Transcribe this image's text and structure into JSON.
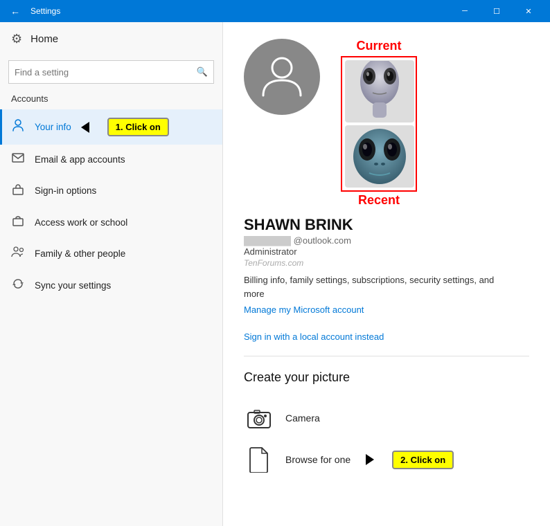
{
  "titlebar": {
    "title": "Settings",
    "back_icon": "←",
    "minimize": "─",
    "maximize": "☐",
    "close": "✕"
  },
  "sidebar": {
    "home_label": "Home",
    "search_placeholder": "Find a setting",
    "section_title": "Accounts",
    "items": [
      {
        "id": "your-info",
        "label": "Your info",
        "icon": "👤",
        "active": true
      },
      {
        "id": "email-app",
        "label": "Email & app accounts",
        "icon": "✉"
      },
      {
        "id": "sign-in",
        "label": "Sign-in options",
        "icon": "🔑"
      },
      {
        "id": "access-work",
        "label": "Access work or school",
        "icon": "💼"
      },
      {
        "id": "family",
        "label": "Family & other people",
        "icon": "👪"
      },
      {
        "id": "sync",
        "label": "Sync your settings",
        "icon": "🔄"
      }
    ]
  },
  "annotations": {
    "badge1": "1. Click on",
    "badge2": "2. Click on"
  },
  "main": {
    "current_label": "Current",
    "recent_label": "Recent",
    "user_name": "SHAWN BRINK",
    "user_email": "@outlook.com",
    "user_role": "Administrator",
    "watermark": "TenForums.com",
    "user_desc": "Billing info, family settings, subscriptions, security settings, and more",
    "manage_link": "Manage my Microsoft account",
    "signin_link": "Sign in with a local account instead",
    "section_title": "Create your picture",
    "options": [
      {
        "id": "camera",
        "label": "Camera"
      },
      {
        "id": "browse",
        "label": "Browse for one"
      }
    ]
  }
}
